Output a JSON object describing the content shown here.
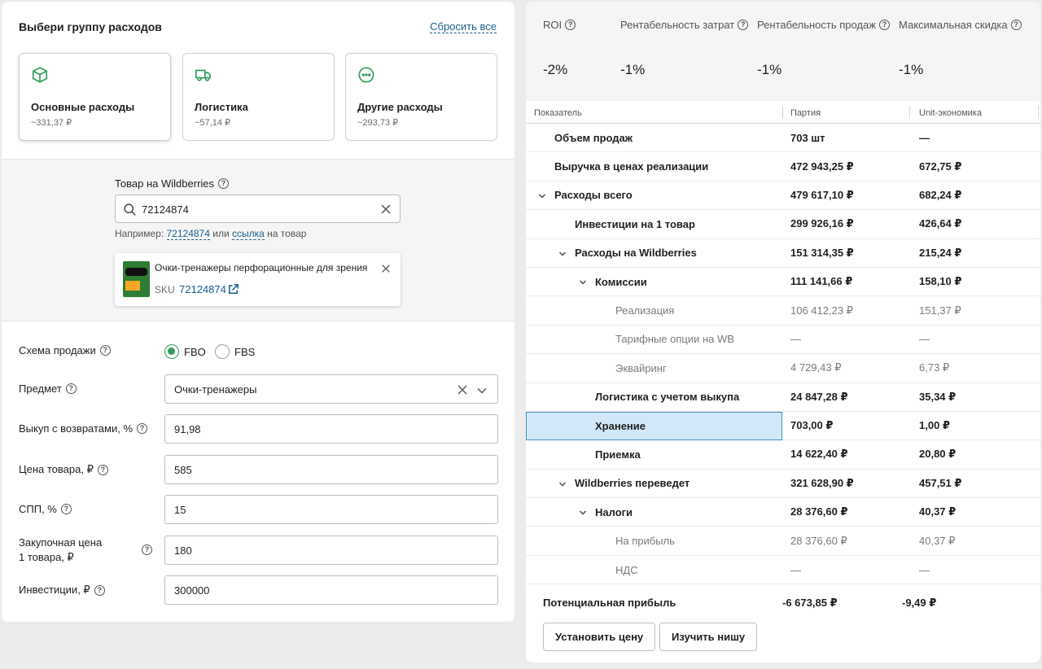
{
  "groups": {
    "title": "Выбери группу расходов",
    "reset_label": "Сбросить все",
    "cards": [
      {
        "name": "Основные расходы",
        "sum": "~331,37 ₽",
        "icon": "box-icon",
        "selected": true
      },
      {
        "name": "Логистика",
        "sum": "~57,14 ₽",
        "icon": "truck-icon",
        "selected": false
      },
      {
        "name": "Другие расходы",
        "sum": "~293,73 ₽",
        "icon": "more-icon",
        "selected": false
      }
    ],
    "accent_color": "#2e9d57"
  },
  "product": {
    "label": "Товар на Wildberries",
    "search_value": "72124874",
    "example_prefix": "Например:",
    "example_sku": "72124874",
    "example_or": "или",
    "example_link": "ссылка",
    "example_suffix": "на товар",
    "item": {
      "title": "Очки-тренажеры перфорационные для зрения",
      "sku_label": "SKU",
      "sku": "72124874"
    }
  },
  "form": {
    "scheme_label": "Схема продажи",
    "scheme_options": [
      "FBO",
      "FBS"
    ],
    "scheme_selected": "FBO",
    "subject_label": "Предмет",
    "subject_value": "Очки-тренажеры",
    "buyout_label": "Выкуп с возвратами, %",
    "buyout_value": "91,98",
    "price_label": "Цена товара, ₽",
    "price_value": "585",
    "spp_label": "СПП, %",
    "spp_value": "15",
    "purchase_label": "Закупочная цена 1 товара, ₽",
    "purchase_value": "180",
    "invest_label": "Инвестиции, ₽",
    "invest_value": "300000"
  },
  "metrics": [
    {
      "label": "ROI",
      "value": "-2%"
    },
    {
      "label": "Рентабельность затрат",
      "value": "-1%"
    },
    {
      "label": "Рентабельность продаж",
      "value": "-1%"
    },
    {
      "label": "Максимальная скидка",
      "value": "-1%"
    }
  ],
  "table": {
    "headers": {
      "name": "Показатель",
      "batch": "Партия",
      "unit": "Unit-экономика"
    },
    "rows": [
      {
        "name": "Объем продаж",
        "batch": "703 шт",
        "unit": "—",
        "level": 0,
        "bold": true,
        "chevron": false
      },
      {
        "name": "Выручка в ценах реализации",
        "batch": "472 943,25 ₽",
        "unit": "672,75 ₽",
        "level": 0,
        "bold": true,
        "chevron": false
      },
      {
        "name": "Расходы всего",
        "batch": "479 617,10 ₽",
        "unit": "682,24 ₽",
        "level": 0,
        "bold": true,
        "chevron": true
      },
      {
        "name": "Инвестиции на 1 товар",
        "batch": "299 926,16 ₽",
        "unit": "426,64 ₽",
        "level": 1,
        "bold": true,
        "chevron": false
      },
      {
        "name": "Расходы на Wildberries",
        "batch": "151 314,35 ₽",
        "unit": "215,24 ₽",
        "level": 1,
        "bold": true,
        "chevron": true
      },
      {
        "name": "Комиссии",
        "batch": "111 141,66 ₽",
        "unit": "158,10 ₽",
        "level": 2,
        "bold": true,
        "chevron": true
      },
      {
        "name": "Реализация",
        "batch": "106 412,23 ₽",
        "unit": "151,37 ₽",
        "level": 3,
        "bold": false,
        "chevron": false
      },
      {
        "name": "Тарифные опции на WB",
        "batch": "—",
        "unit": "—",
        "level": 3,
        "bold": false,
        "chevron": false
      },
      {
        "name": "Эквайринг",
        "batch": "4 729,43 ₽",
        "unit": "6,73 ₽",
        "level": 3,
        "bold": false,
        "chevron": false
      },
      {
        "name": "Логистика с учетом выкупа",
        "batch": "24 847,28 ₽",
        "unit": "35,34 ₽",
        "level": 2,
        "bold": true,
        "chevron": false
      },
      {
        "name": "Хранение",
        "batch": "703,00 ₽",
        "unit": "1,00 ₽",
        "level": 2,
        "bold": true,
        "chevron": false,
        "highlight": true
      },
      {
        "name": "Приемка",
        "batch": "14 622,40 ₽",
        "unit": "20,80 ₽",
        "level": 2,
        "bold": true,
        "chevron": false
      },
      {
        "name": "Wildberries переведет",
        "batch": "321 628,90 ₽",
        "unit": "457,51 ₽",
        "level": 1,
        "bold": true,
        "chevron": true
      },
      {
        "name": "Налоги",
        "batch": "28 376,60 ₽",
        "unit": "40,37 ₽",
        "level": 2,
        "bold": true,
        "chevron": true
      },
      {
        "name": "На прибыль",
        "batch": "28 376,60 ₽",
        "unit": "40,37 ₽",
        "level": 3,
        "bold": false,
        "chevron": false
      },
      {
        "name": "НДС",
        "batch": "—",
        "unit": "—",
        "level": 3,
        "bold": false,
        "chevron": false
      }
    ],
    "profit": {
      "name": "Потенциальная прибыль",
      "batch": "-6 673,85 ₽",
      "unit": "-9,49 ₽"
    }
  },
  "actions": {
    "set_price": "Установить цену",
    "study_niche": "Изучить нишу"
  }
}
